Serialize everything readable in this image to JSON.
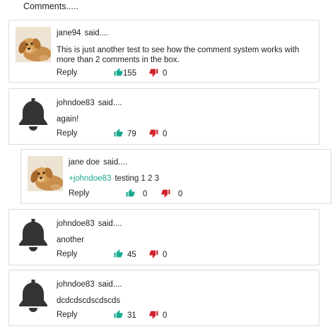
{
  "section_title": "Comments.....",
  "said_label": "said....",
  "reply_label": "Reply",
  "colors": {
    "like": "#1aaa8f",
    "dislike": "#d0242e",
    "mention": "#1aaa8f",
    "bell": "#333333"
  },
  "comments": [
    {
      "author": "jane94",
      "avatar": "dog-photo",
      "lines": [
        "This is just another test to see how the comment system works with",
        "more than 2 comments in the box."
      ],
      "likes": "155",
      "dislikes": "0"
    },
    {
      "author": "johndoe83",
      "avatar": "bell-icon",
      "lines": [
        "again!"
      ],
      "likes": "79",
      "dislikes": "0"
    },
    {
      "author": "jane doe",
      "avatar": "dog-photo",
      "mention": "+johndoe83",
      "lines": [
        "testing 1 2 3"
      ],
      "likes": "0",
      "dislikes": "0"
    },
    {
      "author": "johndoe83",
      "avatar": "bell-icon",
      "lines": [
        "another"
      ],
      "likes": "45",
      "dislikes": "0"
    },
    {
      "author": "johndoe83",
      "avatar": "bell-icon",
      "lines": [
        "dcdcdscdscdscds"
      ],
      "likes": "31",
      "dislikes": "0"
    }
  ]
}
